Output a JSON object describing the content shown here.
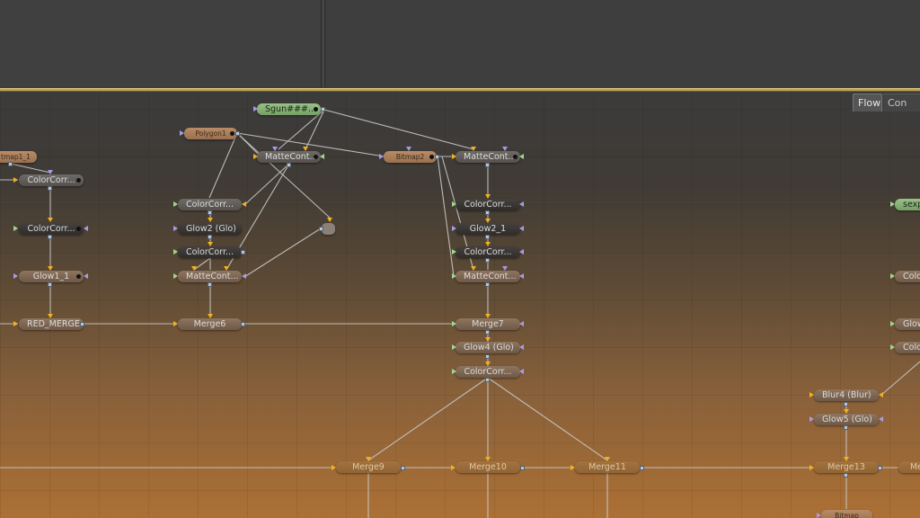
{
  "tabs": {
    "flow": "Flow",
    "console": "Con"
  },
  "nodes": {
    "bitmap1_1": "tmap1_1",
    "colorcorr_a": "ColorCorr...",
    "colorcorr_b": "ColorCorr...",
    "glow1_1": "Glow1_1",
    "red_merge": "RED_MERGE",
    "sgun": "Sgun###...",
    "polygon1": "Polygon1",
    "mattecont_a": "MatteCont...",
    "bitmap2": "Bitmap2",
    "mattecont_b": "MatteCont...",
    "colorcorr_c": "ColorCorr...",
    "glow2_glo": "Glow2 (Glo)",
    "colorcorr_d": "ColorCorr...",
    "mattecont_c": "MatteCont...",
    "merge6": "Merge6",
    "colorcorr_e": "ColorCorr...",
    "glow2_1": "Glow2_1",
    "colorcorr_f": "ColorCorr...",
    "mattecont_d": "MatteCont...",
    "merge7": "Merge7",
    "glow4_glo": "Glow4 (Glo)",
    "colorcorr_g": "ColorCorr...",
    "merge9": "Merge9",
    "merge10": "Merge10",
    "merge11": "Merge11",
    "merge13": "Merge13",
    "merge_cut": "Me",
    "blur4_blur": "Blur4 (Blur)",
    "glow5_glo": "Glow5 (Glo)",
    "bitmap_cut": "Bitmap",
    "sexple": "sexple",
    "color_r1": "Color",
    "glow_r": "Glow",
    "color_r2": "Color"
  },
  "colors": {
    "wire": "#c9c9c9",
    "input_orange": "#f0b020",
    "input_green": "#9ed88e",
    "input_purple": "#a99ae8",
    "accent_divider": "#b9a255"
  }
}
